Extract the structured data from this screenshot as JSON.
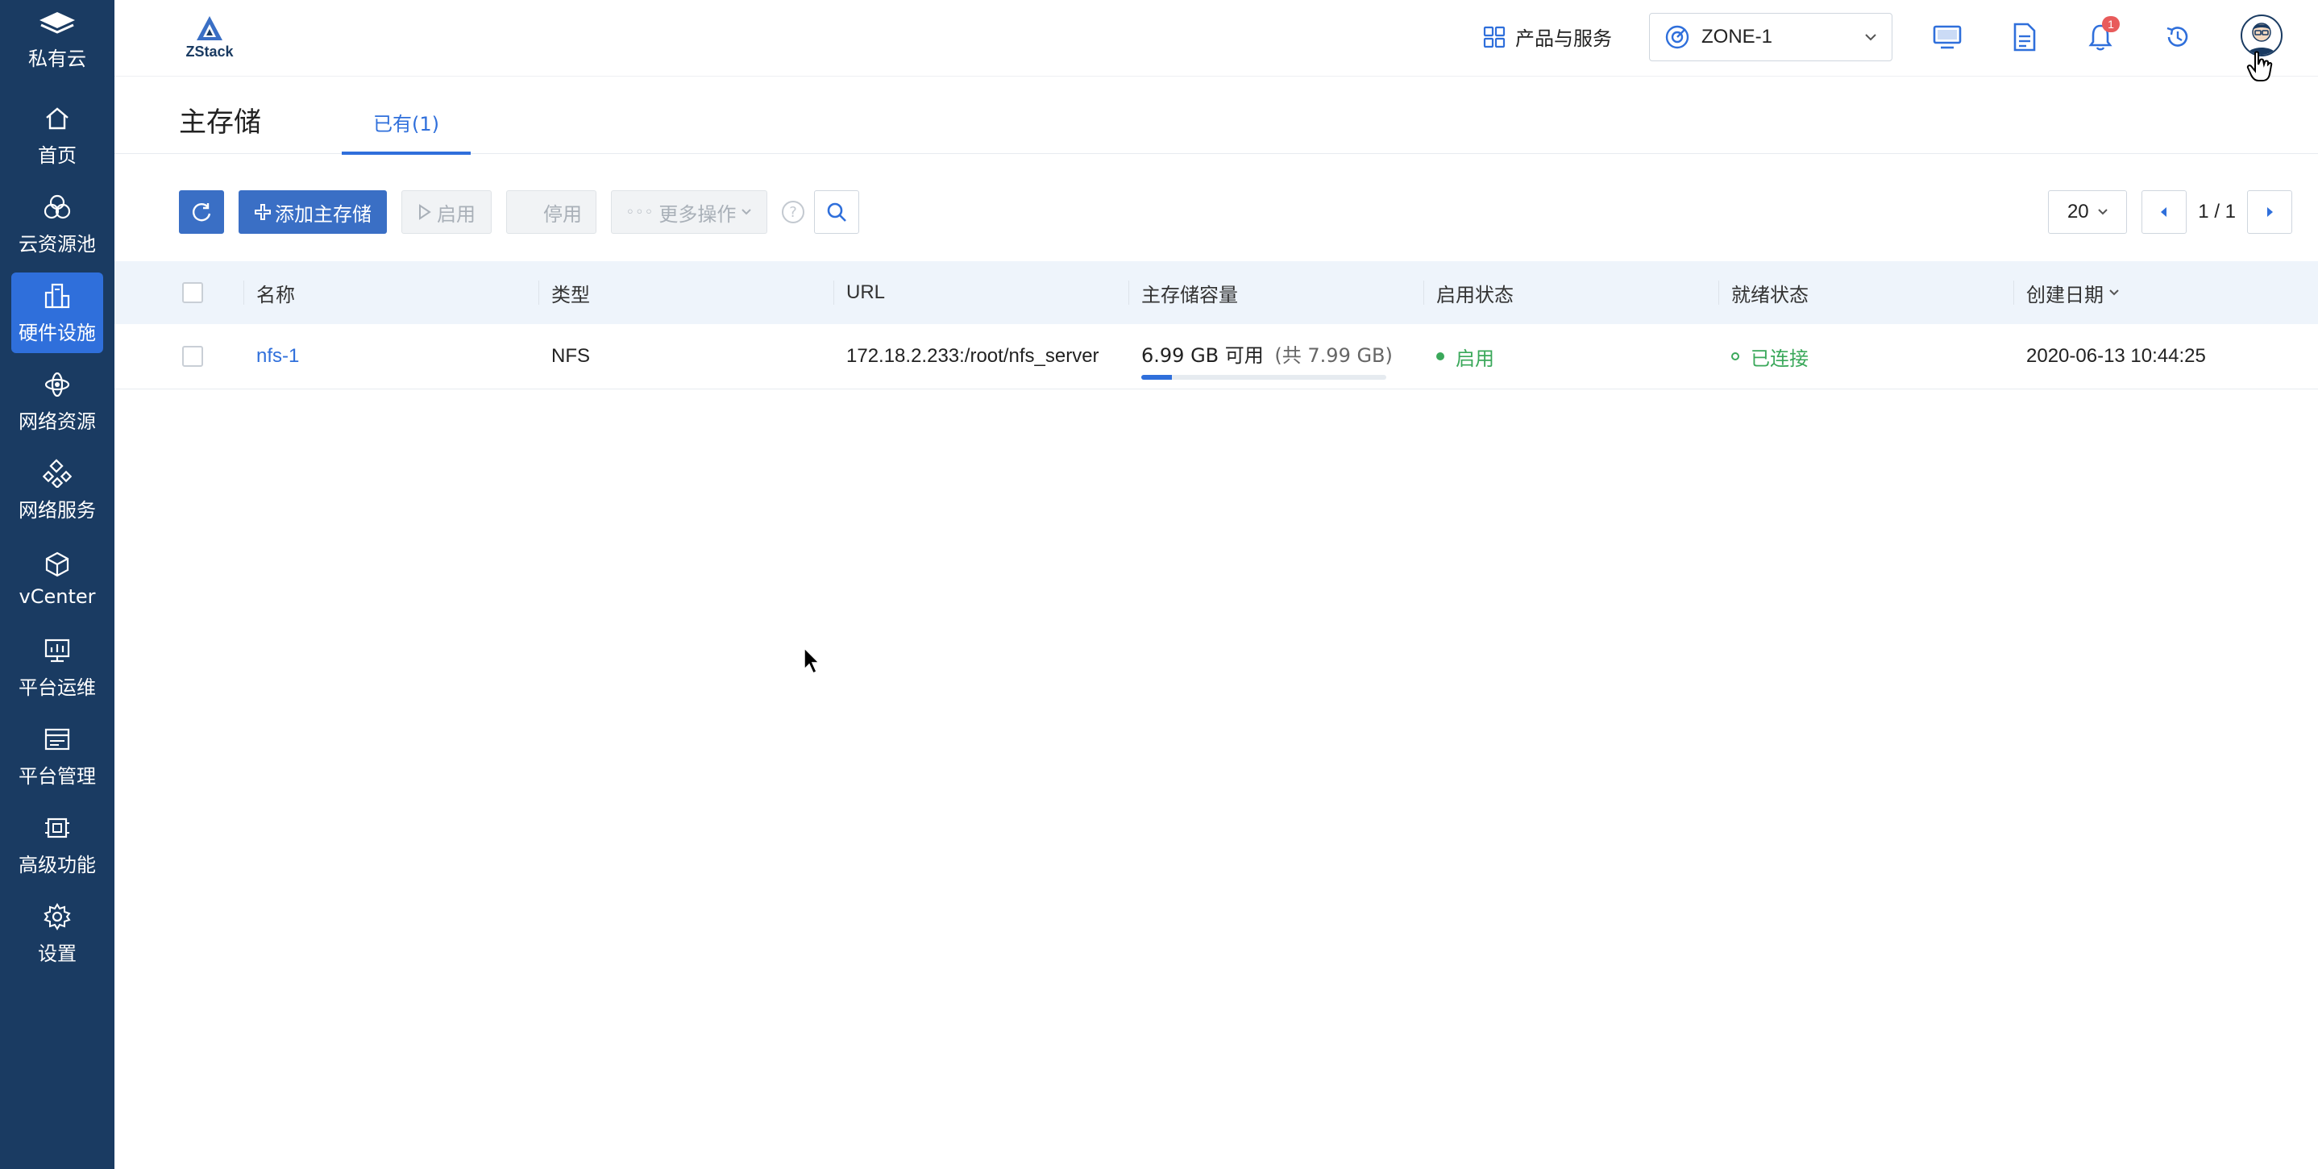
{
  "sidebar": {
    "brand": "私有云",
    "items": [
      {
        "label": "首页",
        "icon": "home-icon"
      },
      {
        "label": "云资源池",
        "icon": "resource-pool-icon"
      },
      {
        "label": "硬件设施",
        "icon": "hardware-icon",
        "active": true
      },
      {
        "label": "网络资源",
        "icon": "network-resource-icon"
      },
      {
        "label": "网络服务",
        "icon": "network-service-icon"
      },
      {
        "label": "vCenter",
        "icon": "cube-icon"
      },
      {
        "label": "平台运维",
        "icon": "monitor-chart-icon"
      },
      {
        "label": "平台管理",
        "icon": "management-icon"
      },
      {
        "label": "高级功能",
        "icon": "advanced-icon"
      },
      {
        "label": "设置",
        "icon": "gear-icon"
      }
    ]
  },
  "topbar": {
    "logo_text": "ZStack",
    "products_label": "产品与服务",
    "zone": "ZONE-1",
    "notification_count": "1"
  },
  "page": {
    "title": "主存储",
    "tab_label": "已有(1)"
  },
  "toolbar": {
    "add_label": "添加主存储",
    "enable_label": "启用",
    "disable_label": "停用",
    "more_label": "更多操作"
  },
  "pager": {
    "page_size": "20",
    "page_text": "1 / 1"
  },
  "table": {
    "headers": {
      "name": "名称",
      "type": "类型",
      "url": "URL",
      "capacity": "主存储容量",
      "enable_state": "启用状态",
      "ready_state": "就绪状态",
      "created": "创建日期"
    },
    "rows": [
      {
        "name": "nfs-1",
        "type": "NFS",
        "url": "172.18.2.233:/root/nfs_server",
        "capacity_available": "6.99 GB 可用",
        "capacity_total": "(共 7.99 GB)",
        "capacity_used_fraction": 0.125,
        "enable_state": "启用",
        "ready_state": "已连接",
        "created": "2020-06-13 10:44:25"
      }
    ]
  },
  "colors": {
    "sidebar_bg": "#1a3b62",
    "accent": "#2f6fdb",
    "status_green": "#3aa85a",
    "badge_red": "#e85b5b"
  }
}
